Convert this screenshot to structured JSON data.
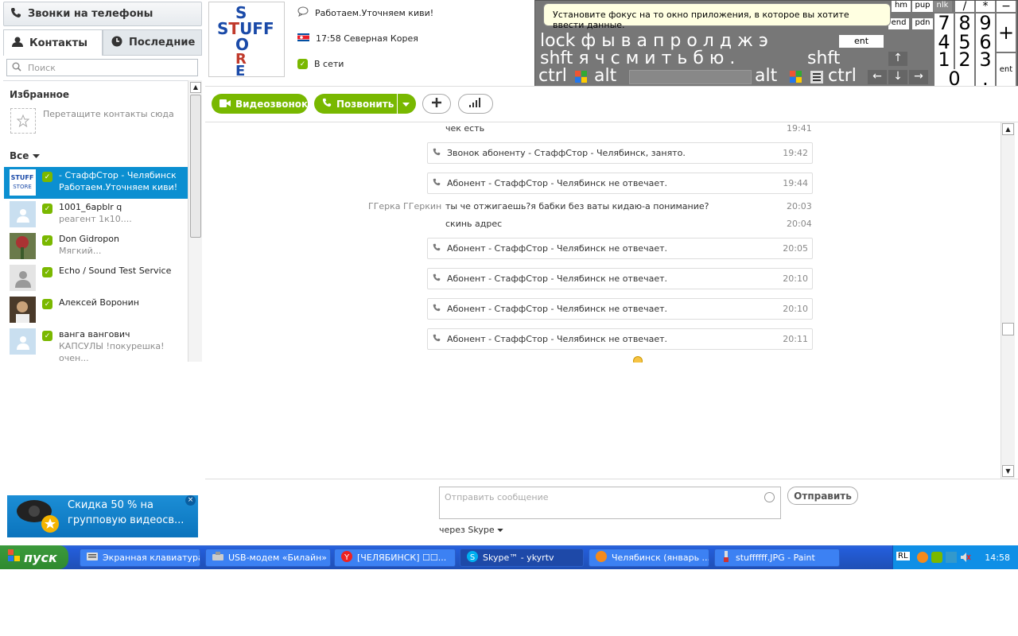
{
  "sidebar": {
    "calls_label": "Звонки на телефоны",
    "tabs": [
      {
        "label": "Контакты"
      },
      {
        "label": "Последние"
      }
    ],
    "search_placeholder": "Поиск",
    "favorites_title": "Избранное",
    "favorites_hint": "Перетащите контакты сюда",
    "all_label": "Все",
    "contacts": [
      {
        "name": "- СтаффСтор - Челябинск",
        "mood": "Работаем.Уточняем киви!"
      },
      {
        "name": "1001_6apblr q",
        "mood": "реагент 1к10...."
      },
      {
        "name": "Don Gidropon",
        "mood": "Мягкий..."
      },
      {
        "name": "Echo / Sound Test Service",
        "mood": ""
      },
      {
        "name": "Алексей Воронин",
        "mood": ""
      },
      {
        "name": "ванга вангович",
        "mood": "КАПСУЛЫ !покурешка!очен..."
      }
    ],
    "ad_text": "Скидка 50 % на групповую видеосв..."
  },
  "profile": {
    "logo_text": "STUFF STORE",
    "mood": "Работаем.Уточняем киви!",
    "localtime": "17:58 Северная Корея",
    "status": "В сети"
  },
  "toolbar": {
    "video_call": "Видеозвонок",
    "call": "Позвонить"
  },
  "chat": {
    "messages": [
      {
        "kind": "text",
        "sender": "",
        "text": "чек есть",
        "time": "19:41"
      },
      {
        "kind": "call",
        "text": "Звонок абоненту - СтаффСтор -  Челябинск, занято.",
        "time": "19:42"
      },
      {
        "kind": "call",
        "text": "Абонент - СтаффСтор -  Челябинск не отвечает.",
        "time": "19:44"
      },
      {
        "kind": "text",
        "sender": "ГГерка ГГеркин",
        "text": "ты че отжигаешь?я бабки без ваты кидаю-а понимание?",
        "time": "20:03"
      },
      {
        "kind": "text",
        "sender": "",
        "text": "скинь адрес",
        "time": "20:04"
      },
      {
        "kind": "call",
        "text": "Абонент - СтаффСтор -  Челябинск не отвечает.",
        "time": "20:05"
      },
      {
        "kind": "call",
        "text": "Абонент - СтаффСтор -  Челябинск не отвечает.",
        "time": "20:10"
      },
      {
        "kind": "call",
        "text": "Абонент - СтаффСтор -  Челябинск не отвечает.",
        "time": "20:10"
      },
      {
        "kind": "call",
        "text": "Абонент - СтаффСтор -  Челябинск не отвечает.",
        "time": "20:11"
      }
    ],
    "input_placeholder": "Отправить сообщение",
    "send_label": "Отправить",
    "via_label": "через Skype"
  },
  "osk": {
    "tooltip": "Установите фокус на то окно приложения, в которое вы хотите ввести данные.",
    "row2": "lock ф ы в а п р о л д ж э",
    "row3": "shft я ч с м и т ь б ю .",
    "shft_right": "shft",
    "ent": "ent",
    "ctrl": "ctrl",
    "alt": "alt",
    "hm": "hm",
    "pup": "pup",
    "nlk": "nlk",
    "end": "end",
    "pdn": "pdn",
    "numrow1": [
      "7",
      "8",
      "9"
    ],
    "numrow2": [
      "4",
      "5",
      "6"
    ],
    "numrow3": [
      "1",
      "2",
      "3"
    ],
    "num0": "0",
    "numdot": ".",
    "numslash": "/",
    "numstar": "*",
    "numminus": "−",
    "numplus": "+"
  },
  "taskbar": {
    "start": "пуск",
    "tasks": [
      {
        "label": "Экранная клавиатура"
      },
      {
        "label": "USB-модем «Билайн»"
      },
      {
        "label": "[ЧЕЛЯБИНСК] ☐☐..."
      },
      {
        "label": "Skype™ - ykyrtv"
      },
      {
        "label": "Челябинск (январь ..."
      },
      {
        "label": "stuffffff.JPG - Paint"
      }
    ],
    "lang": "RL",
    "clock": "14:58"
  }
}
